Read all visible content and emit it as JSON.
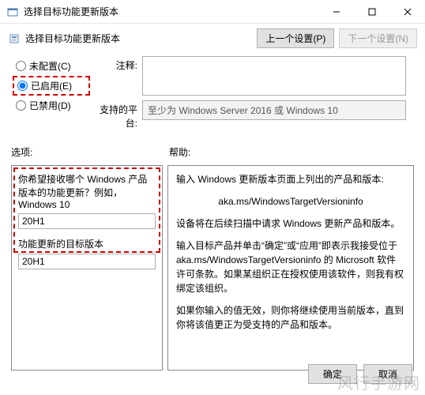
{
  "window": {
    "title": "选择目标功能更新版本",
    "minimize_name": "minimize",
    "maximize_name": "maximize",
    "close_name": "close"
  },
  "subheader": {
    "title": "选择目标功能更新版本",
    "prev_label": "上一个设置(P)",
    "next_label": "下一个设置(N)"
  },
  "radios": {
    "not_configured": "未配置(C)",
    "enabled": "已启用(E)",
    "disabled": "已禁用(D)"
  },
  "fields": {
    "comment_label": "注释:",
    "comment_value": "",
    "platform_label": "支持的平台:",
    "platform_value": "至少为 Windows Server 2016 或 Windows 10"
  },
  "sections": {
    "options_label": "选项:",
    "help_label": "帮助:"
  },
  "options": {
    "q1_label": "你希望接收哪个 Windows 产品版本的功能更新？例如，Windows 10",
    "q1_value": "20H1",
    "q2_label": "功能更新的目标版本",
    "q2_value": "20H1"
  },
  "help": {
    "p1": "输入 Windows 更新版本页面上列出的产品和版本:",
    "p2": "aka.ms/WindowsTargetVersioninfo",
    "p3": "设备将在后续扫描中请求 Windows 更新产品和版本。",
    "p4": "输入目标产品并单击“确定”或“应用”即表示我接受位于 aka.ms/WindowsTargetVersioninfo 的 Microsoft 软件许可条款。如果某组织正在授权使用该软件，则我有权绑定该组织。",
    "p5": "如果你输入的值无效，则你将继续使用当前版本，直到你将该值更正为受支持的产品和版本。"
  },
  "buttons": {
    "ok": "确定",
    "cancel": "取消"
  },
  "watermark": "风行手游网"
}
